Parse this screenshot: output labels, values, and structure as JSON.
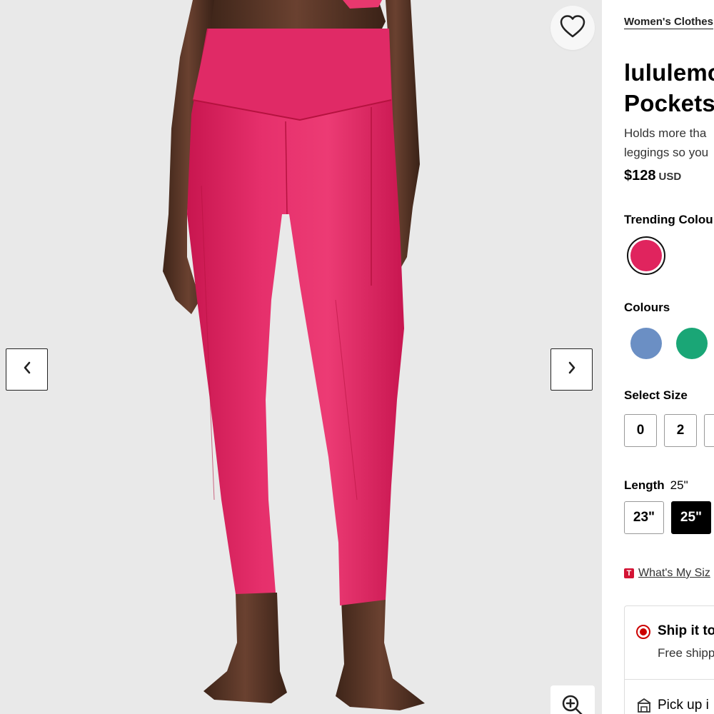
{
  "gallery": {
    "favorite_icon": "heart-icon",
    "prev_icon": "chevron-left-icon",
    "next_icon": "chevron-right-icon",
    "zoom_icon": "zoom-in-icon"
  },
  "product": {
    "breadcrumb": "Women's Clothes",
    "title_line1": "lululemo",
    "title_line2": "Pockets",
    "desc_line1": "Holds more tha",
    "desc_line2": "leggings so you",
    "price": "$128",
    "currency": "USD"
  },
  "trending": {
    "label": "Trending Colou",
    "selected_color": "#e0245e"
  },
  "colours": {
    "label": "Colours",
    "swatches": [
      "#6b8fc4",
      "#1aa676"
    ]
  },
  "size": {
    "label": "Select Size",
    "options": [
      "0",
      "2"
    ]
  },
  "length": {
    "label": "Length",
    "value": "25\"",
    "options": [
      "23\"",
      "25\""
    ],
    "selected": "25\""
  },
  "size_help": {
    "badge": "T",
    "text": "What's My Siz"
  },
  "fulfillment": {
    "ship_title": "Ship it to",
    "ship_sub": "Free shipp",
    "pickup_title": "Pick up i",
    "accent": "#cc0000"
  }
}
